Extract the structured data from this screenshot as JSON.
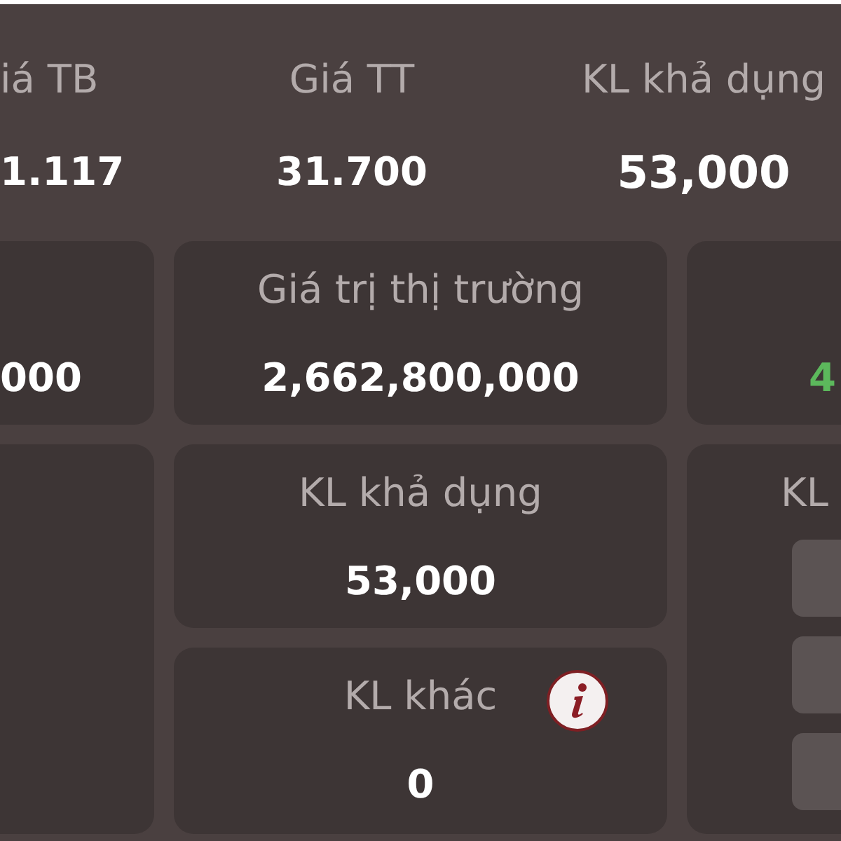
{
  "summary": [
    {
      "label": "iá TB",
      "value": "1.117",
      "large": false
    },
    {
      "label": "Giá TT",
      "value": "31.700",
      "large": false
    },
    {
      "label": "KL khả dụng",
      "value": "53,000",
      "large": true
    }
  ],
  "left_column": {
    "value_card": {
      "value": "000",
      "positive": false
    }
  },
  "center_column": [
    {
      "label": "Giá trị thị trường",
      "value": "2,662,800,000",
      "info": false
    },
    {
      "label": "KL khả dụng",
      "value": "53,000",
      "info": false
    },
    {
      "label": "KL khác",
      "value": "0",
      "info": true
    }
  ],
  "right_column": {
    "value_card": {
      "value": "4",
      "positive": true
    },
    "tall_card": {
      "label": "KL"
    }
  }
}
